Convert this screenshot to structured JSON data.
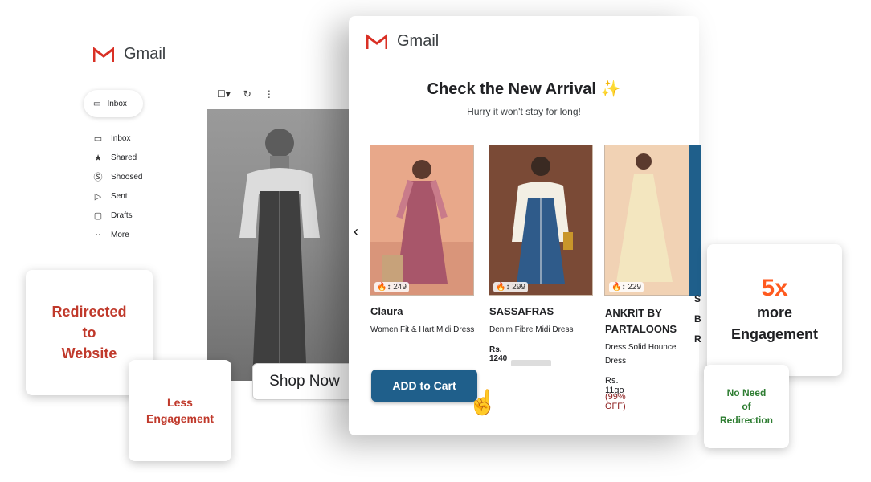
{
  "back_gmail": {
    "app_name": "Gmail",
    "nav_pill_label": "Inbox",
    "nav_items": [
      {
        "label": "Inbox",
        "icon": "inbox-icon"
      },
      {
        "label": "Shared",
        "icon": "star-icon"
      },
      {
        "label": "Shoosed",
        "icon": "snooze-icon"
      },
      {
        "label": "Sent",
        "icon": "send-icon"
      },
      {
        "label": "Drafts",
        "icon": "draft-icon"
      },
      {
        "label": "More",
        "icon": "more-icon"
      }
    ],
    "shop_now_label": "Shop Now"
  },
  "front_gmail": {
    "app_name": "Gmail",
    "title": "Check the New Arrival",
    "title_emoji": "✨",
    "subtitle": "Hurry it won't stay for long!",
    "products": [
      {
        "likes": "249",
        "brand": "Claura",
        "desc": "Women Fit & Hart Midi Dress",
        "price": "",
        "discount": "",
        "dress_color": "#a8566a",
        "bg_color": "#e8a88a"
      },
      {
        "likes": "299",
        "brand": "SASSAFRAS",
        "desc": "Denim Fibre Midi Dress",
        "price": "Rs. 1240",
        "discount": "",
        "dress_color": "#2f5b8a",
        "bg_color": "#7a4a36"
      },
      {
        "likes": "229",
        "brand": "ANKRIT BY PARTALOONS",
        "desc": "Dress Solid Hounce Dress",
        "price": "Rs. 11go",
        "discount": "(99% OFF)",
        "dress_color": "#f3e6bf",
        "bg_color": "#f1d2b4"
      }
    ],
    "add_to_cart_label": "ADD to Cart",
    "side_letters": [
      "S",
      "B",
      "R"
    ]
  },
  "callouts": {
    "redirected": [
      "Redirected",
      "to",
      "Website"
    ],
    "less": [
      "Less",
      "Engagement"
    ],
    "more_big": "5x",
    "more": [
      "more",
      "Engagement"
    ],
    "no_need": [
      "No Need",
      "of",
      "Redirection"
    ]
  },
  "colors": {
    "gmail_red": "#d93025",
    "cart_blue": "#1f5f8b",
    "callout_red": "#c0392b",
    "callout_orange": "#ff5a1f",
    "callout_green": "#2e7d32"
  }
}
